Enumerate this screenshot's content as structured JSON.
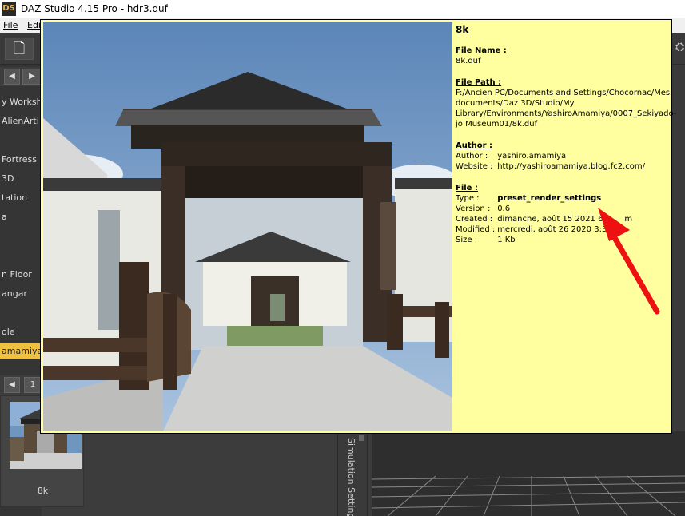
{
  "window": {
    "app_icon": "DS",
    "title": "DAZ Studio 4.15 Pro - hdr3.duf"
  },
  "menu": {
    "file": "File",
    "edit": "Edi"
  },
  "toolbar": {
    "new_icon": "new-document-icon",
    "right_icon": "scene-icon"
  },
  "left_panel": {
    "items": [
      "y Worksh",
      "AlienArti",
      "Fortress",
      "3D",
      "tation",
      "a",
      "n Floor",
      "angar",
      "ole",
      "amamiya"
    ],
    "selected_index": 9,
    "page_number": "1"
  },
  "thumbnail": {
    "label": "8k"
  },
  "sim_tab": {
    "label": "Simulation Settings"
  },
  "tooltip": {
    "name": "8k",
    "file_name": {
      "header": "File Name :",
      "value": "8k.duf"
    },
    "file_path": {
      "header": "File Path :",
      "lines": [
        "F:/Ancien PC/Documents and Settings/Chocornac/Mes",
        "documents/Daz 3D/Studio/My",
        "Library/Environments/YashiroAmamiya/0007_Sekiyado-",
        "jo Museum01/8k.duf"
      ]
    },
    "author": {
      "header": "Author :",
      "author_label": "Author :",
      "author_value": "yashiro.amamiya",
      "website_label": "Website :",
      "website_value": "http://yashiroamamiya.blog.fc2.com/"
    },
    "file": {
      "header": "File :",
      "type_label": "Type :",
      "type_value": "preset_render_settings",
      "version_label": "Version :",
      "version_value": "0.6",
      "created_label": "Created :",
      "created_value": "dimanche, août 15 2021 6:3",
      "created_tail": "m",
      "modified_label": "Modified :",
      "modified_value": "mercredi, août 26 2020 3:31 p",
      "size_label": "Size :",
      "size_value": "1 Kb"
    }
  },
  "colors": {
    "tooltip_bg": "#ffffa0",
    "arrow": "#ee1111",
    "selected": "#f0c040"
  }
}
